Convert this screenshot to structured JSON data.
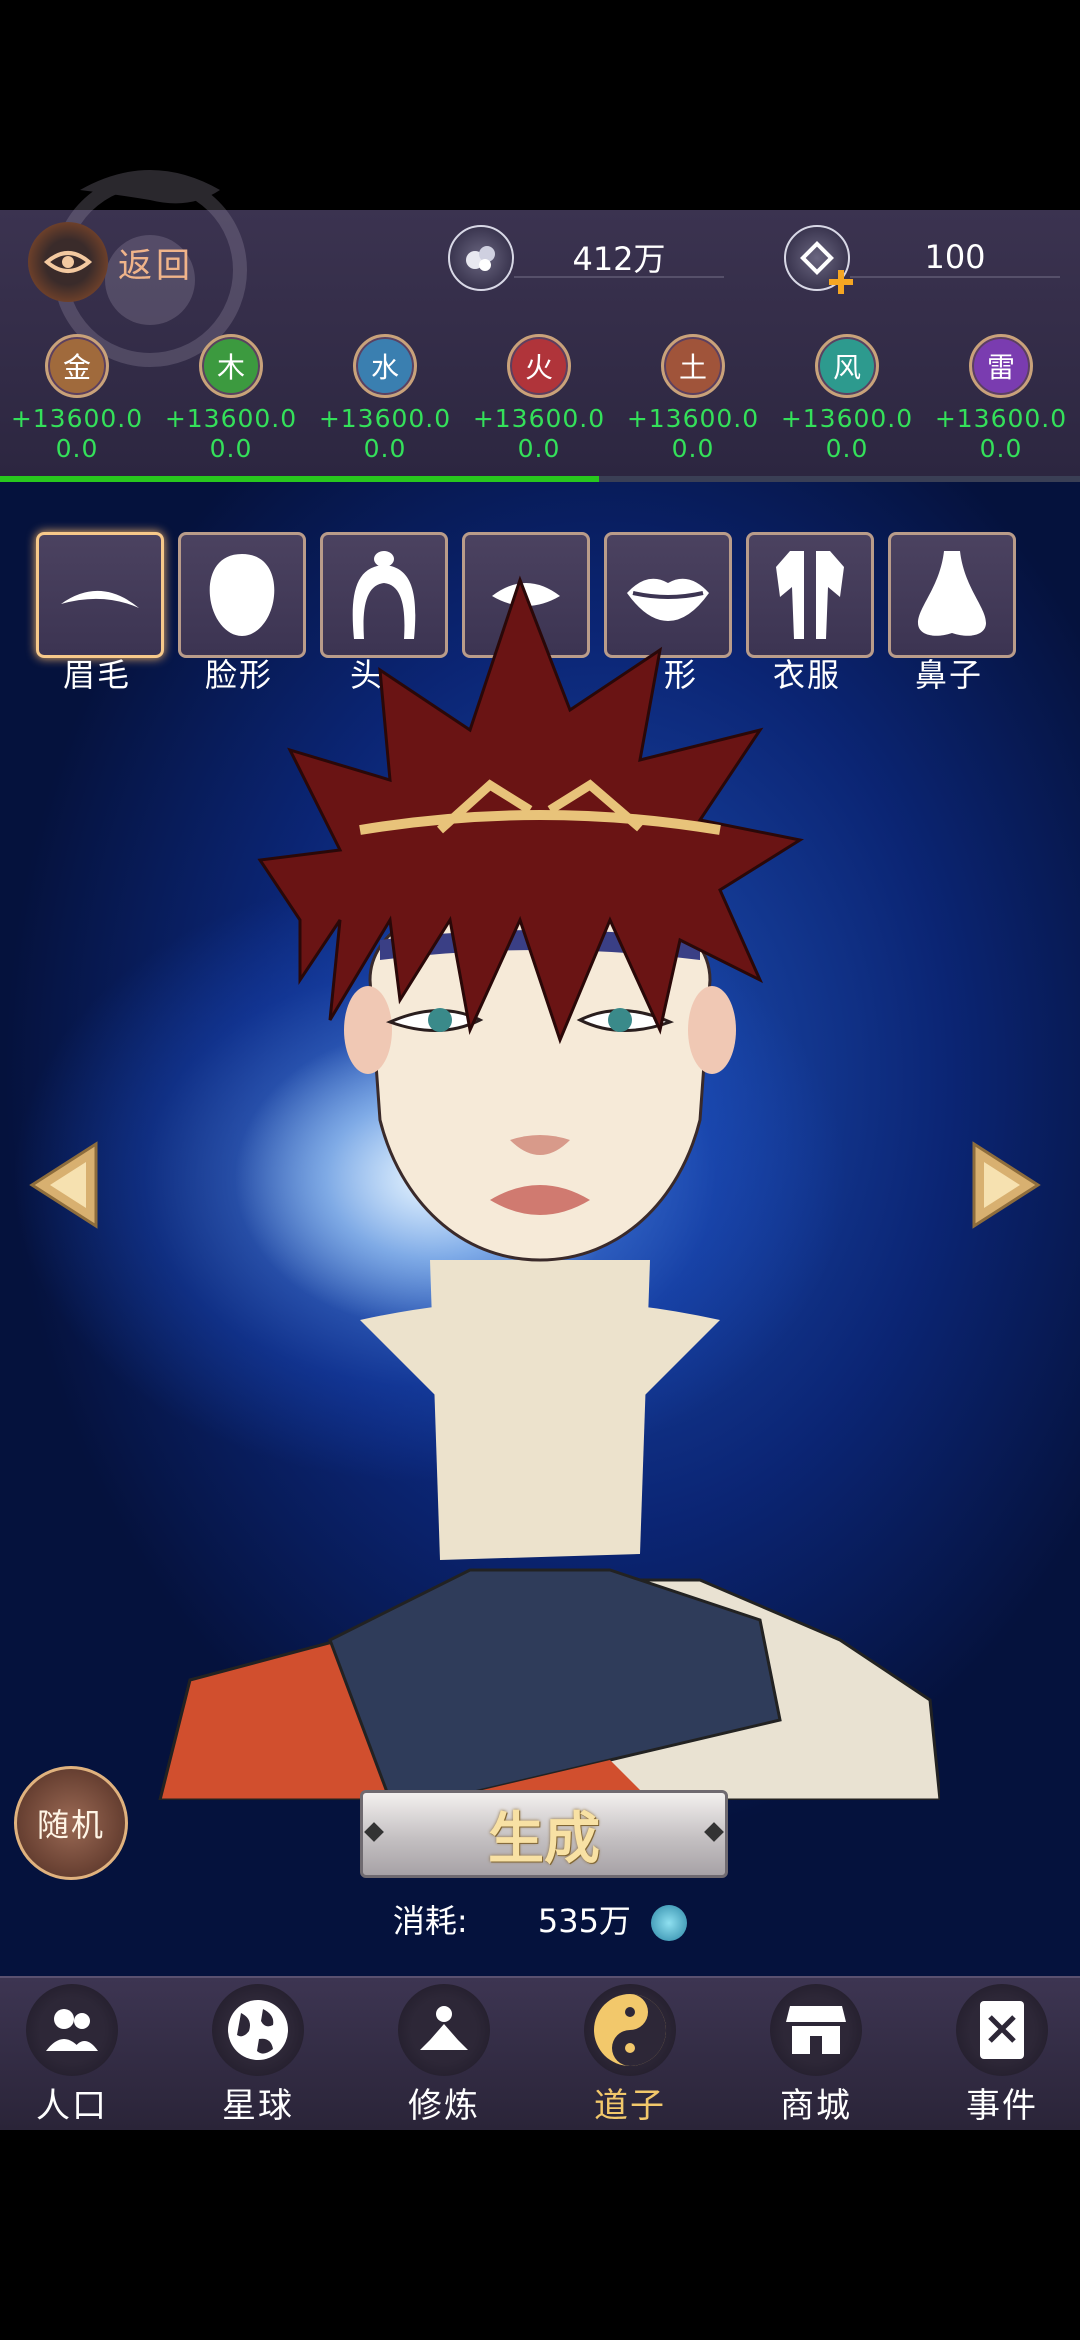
{
  "header": {
    "back_label": "返回",
    "spirit_stones": "412万",
    "gems": "100"
  },
  "elements": [
    {
      "name": "金",
      "amount": "+13600.00.0",
      "color": "#a06a3c"
    },
    {
      "name": "木",
      "amount": "+13600.00.0",
      "color": "#3c9a3f"
    },
    {
      "name": "水",
      "amount": "+13600.00.0",
      "color": "#3a7fb0"
    },
    {
      "name": "火",
      "amount": "+13600.00.0",
      "color": "#b0343a"
    },
    {
      "name": "土",
      "amount": "+13600.00.0",
      "color": "#a0543a"
    },
    {
      "name": "风",
      "amount": "+13600.00.0",
      "color": "#2d9a8e"
    },
    {
      "name": "雷",
      "amount": "+13600.00.0",
      "color": "#7a3cb0"
    }
  ],
  "progress": {
    "fraction": 0.555
  },
  "tabs": [
    {
      "label": "眉毛",
      "icon": "eyebrow-icon",
      "active": true
    },
    {
      "label": "脸形",
      "icon": "face-shape-icon"
    },
    {
      "label": "头",
      "icon": "hair-icon"
    },
    {
      "label": "",
      "icon": "eye-icon"
    },
    {
      "label": "形",
      "icon": "mouth-icon"
    },
    {
      "label": "衣服",
      "icon": "clothes-icon"
    },
    {
      "label": "鼻子",
      "icon": "nose-icon"
    }
  ],
  "actions": {
    "random_label": "随机",
    "generate_label": "生成",
    "cost_label": "消耗:",
    "cost_value": "535万"
  },
  "nav": [
    {
      "label": "人口",
      "icon": "population-icon"
    },
    {
      "label": "星球",
      "icon": "planet-icon"
    },
    {
      "label": "修炼",
      "icon": "cultivate-icon"
    },
    {
      "label": "道子",
      "icon": "yin-yang-icon",
      "active": true
    },
    {
      "label": "商城",
      "icon": "shop-icon"
    },
    {
      "label": "事件",
      "icon": "event-book-icon"
    }
  ]
}
